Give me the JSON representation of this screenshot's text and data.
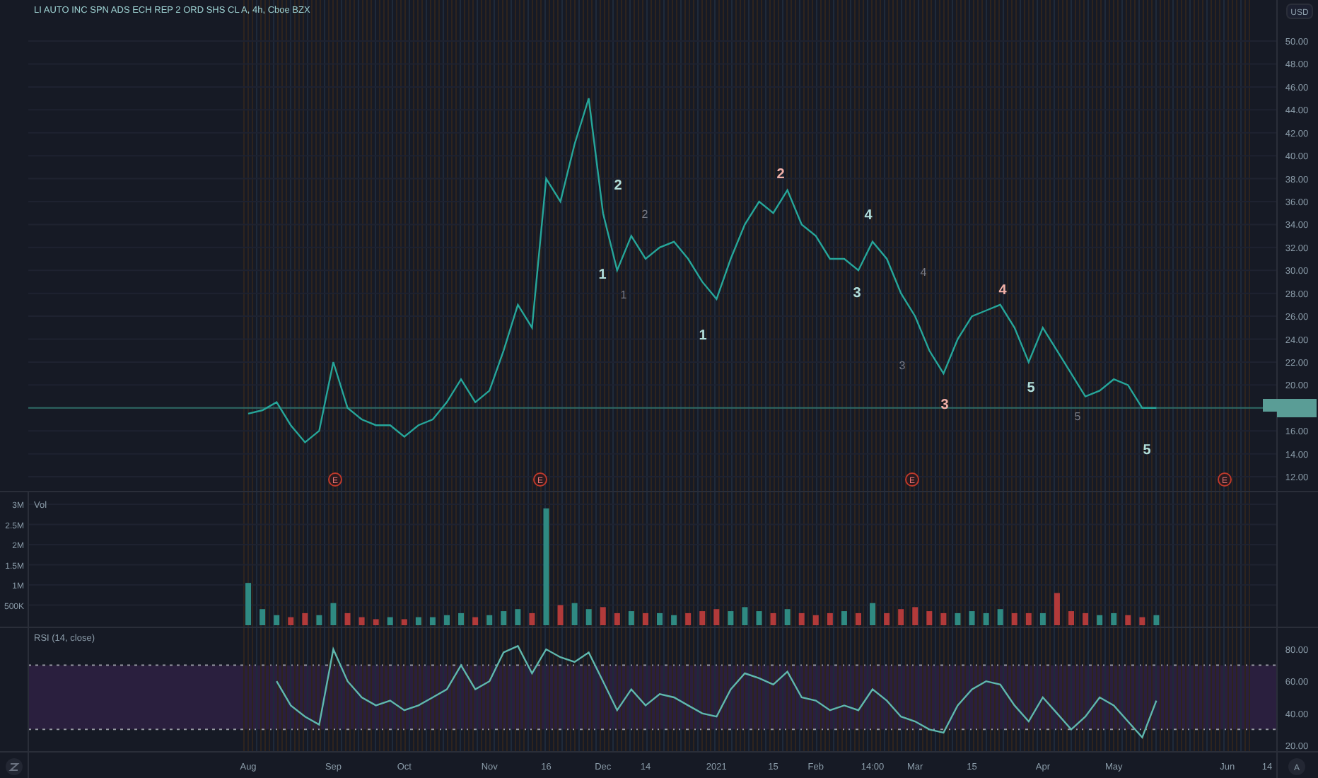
{
  "title": "LI AUTO INC SPN ADS ECH REP 2 ORD SHS CL A, 4h, Cboe BZX",
  "currency": "USD",
  "main": {
    "chart_data": {
      "type": "line",
      "grid": true,
      "ylim": [
        10.77,
        53.58
      ],
      "series": [
        {
          "color": "#26a69a",
          "values": [
            null,
            null,
            null,
            null,
            null,
            null,
            null,
            null,
            null,
            null,
            null,
            null,
            null,
            null,
            null,
            17.5,
            17.8,
            18.5,
            16.5,
            15,
            16,
            22,
            18,
            17,
            16.5,
            16.5,
            15.5,
            16.5,
            17,
            18.5,
            20.5,
            18.5,
            19.5,
            23,
            27,
            25,
            38,
            36,
            41,
            45,
            35,
            30,
            33,
            31,
            32,
            32.5,
            31,
            29,
            27.5,
            31,
            34,
            36,
            35,
            37,
            34,
            33,
            31,
            31,
            30,
            32.5,
            31,
            28,
            26,
            23,
            21,
            24,
            26,
            26.5,
            27,
            25,
            22,
            25,
            23,
            21,
            19,
            19.5,
            20.5,
            20,
            18,
            18,
            null,
            null,
            null,
            null,
            null,
            null,
            null,
            null
          ]
        }
      ],
      "ref_lines": [
        {
          "axis": "y",
          "value": 18
        }
      ],
      "yticks": [
        {
          "value": 12,
          "label": "12.00"
        },
        {
          "value": 14,
          "label": "14.00"
        },
        {
          "value": 16,
          "label": "16.00"
        },
        {
          "value": 20,
          "label": "20.00"
        },
        {
          "value": 22,
          "label": "22.00"
        },
        {
          "value": 24,
          "label": "24.00"
        },
        {
          "value": 26,
          "label": "26.00"
        },
        {
          "value": 28,
          "label": "28.00"
        },
        {
          "value": 30,
          "label": "30.00"
        },
        {
          "value": 32,
          "label": "32.00"
        },
        {
          "value": 34,
          "label": "34.00"
        },
        {
          "value": 36,
          "label": "36.00"
        },
        {
          "value": 38,
          "label": "38.00"
        },
        {
          "value": 40,
          "label": "40.00"
        },
        {
          "value": 42,
          "label": "42.00"
        },
        {
          "value": 44,
          "label": "44.00"
        },
        {
          "value": 46,
          "label": "46.00"
        },
        {
          "value": 48,
          "label": "48.00"
        },
        {
          "value": 50,
          "label": "50.00"
        }
      ]
    },
    "wave_labels": [
      {
        "kind": "major",
        "label": "2",
        "color": "#b2dfdb"
      },
      {
        "kind": "minor",
        "label": "2",
        "color": "#787b86"
      },
      {
        "kind": "major",
        "label": "1",
        "color": "#b2dfdb"
      },
      {
        "kind": "minor",
        "label": "1",
        "color": "#787b86"
      },
      {
        "kind": "major",
        "label": "1",
        "color": "#b2dfdb"
      },
      {
        "kind": "major",
        "label": "2",
        "color": "#f0b0a8"
      },
      {
        "kind": "major",
        "label": "4",
        "color": "#b2dfdb"
      },
      {
        "kind": "major",
        "label": "3",
        "color": "#b2dfdb"
      },
      {
        "kind": "minor",
        "label": "4",
        "color": "#787b86"
      },
      {
        "kind": "minor",
        "label": "3",
        "color": "#787b86"
      },
      {
        "kind": "major",
        "label": "3",
        "color": "#f0b0a8"
      },
      {
        "kind": "major",
        "label": "4",
        "color": "#f0b0a8"
      },
      {
        "kind": "major",
        "label": "5",
        "color": "#b2dfdb"
      },
      {
        "kind": "minor",
        "label": "5",
        "color": "#787b86"
      },
      {
        "kind": "major",
        "label": "5",
        "color": "#b2dfdb"
      }
    ],
    "earnings_markers": [
      {
        "label": "E"
      },
      {
        "label": "E"
      },
      {
        "label": "E"
      },
      {
        "label": "E"
      }
    ]
  },
  "volume": {
    "label": "Vol",
    "chart_data": {
      "type": "bar",
      "grid": true,
      "ylim": [
        0,
        3300000
      ],
      "series": [
        {
          "values": [
            null,
            null,
            null,
            null,
            null,
            null,
            null,
            null,
            null,
            null,
            null,
            null,
            null,
            null,
            null,
            1050000,
            400000,
            250000,
            200000,
            300000,
            250000,
            550000,
            300000,
            200000,
            150000,
            200000,
            150000,
            200000,
            200000,
            250000,
            300000,
            200000,
            250000,
            350000,
            400000,
            300000,
            2900000,
            500000,
            550000,
            400000,
            450000,
            300000,
            350000,
            300000,
            300000,
            250000,
            300000,
            350000,
            400000,
            350000,
            450000,
            350000,
            300000,
            400000,
            300000,
            250000,
            300000,
            350000,
            300000,
            550000,
            300000,
            400000,
            450000,
            350000,
            300000,
            300000,
            350000,
            300000,
            400000,
            300000,
            300000,
            300000,
            800000,
            350000,
            300000,
            250000,
            300000,
            250000,
            200000,
            250000,
            null,
            null,
            null,
            null,
            null,
            null,
            null,
            null
          ]
        }
      ],
      "yticks": [
        {
          "value": 500000,
          "label": "500K"
        },
        {
          "value": 1000000,
          "label": "1M"
        },
        {
          "value": 1500000,
          "label": "1.5M"
        },
        {
          "value": 2000000,
          "label": "2M"
        },
        {
          "value": 2500000,
          "label": "2.5M"
        },
        {
          "value": 3000000,
          "label": "3M"
        }
      ]
    }
  },
  "rsi": {
    "label": "RSI (14, close)",
    "chart_data": {
      "type": "line",
      "ylim": [
        15.6,
        93.2
      ],
      "categories": [
        null,
        null,
        null,
        null,
        null,
        null,
        null,
        null,
        null,
        null,
        null,
        null,
        null,
        null,
        null,
        "Aug",
        null,
        null,
        null,
        null,
        null,
        "Sep",
        null,
        null,
        null,
        null,
        "Oct",
        null,
        null,
        null,
        null,
        null,
        "Nov",
        null,
        null,
        null,
        "16",
        null,
        null,
        null,
        "Dec",
        null,
        null,
        "14",
        null,
        null,
        null,
        null,
        "2021",
        null,
        null,
        null,
        "15",
        null,
        null,
        "Feb",
        null,
        null,
        null,
        "14:00",
        null,
        null,
        "Mar",
        null,
        null,
        null,
        "15",
        null,
        null,
        null,
        null,
        "Apr",
        null,
        null,
        null,
        null,
        "May",
        null,
        null,
        null,
        null,
        null,
        null,
        null,
        "Jun",
        null,
        null,
        "14"
      ],
      "series": [
        {
          "color": "#5fb8ae",
          "values": [
            null,
            null,
            null,
            null,
            null,
            null,
            null,
            null,
            null,
            null,
            null,
            null,
            null,
            null,
            null,
            null,
            null,
            60,
            45,
            38,
            33,
            80,
            60,
            50,
            45,
            48,
            42,
            45,
            50,
            55,
            70,
            55,
            60,
            78,
            82,
            65,
            80,
            75,
            72,
            78,
            60,
            42,
            55,
            45,
            52,
            50,
            45,
            40,
            38,
            55,
            65,
            62,
            58,
            66,
            50,
            48,
            42,
            45,
            42,
            55,
            48,
            38,
            35,
            30,
            28,
            45,
            55,
            60,
            58,
            45,
            35,
            50,
            40,
            30,
            38,
            50,
            45,
            35,
            25,
            48,
            null,
            null,
            null,
            null,
            null,
            null,
            null,
            null
          ]
        }
      ],
      "ref_lines": [
        {
          "axis": "y",
          "value": 30
        },
        {
          "axis": "y",
          "value": 70
        }
      ],
      "yticks": [
        {
          "value": 20,
          "label": "20.00"
        },
        {
          "value": 40,
          "label": "40.00"
        },
        {
          "value": 60,
          "label": "60.00"
        },
        {
          "value": 80,
          "label": "80.00"
        }
      ]
    }
  },
  "autoscale_button": {
    "label": "A"
  }
}
